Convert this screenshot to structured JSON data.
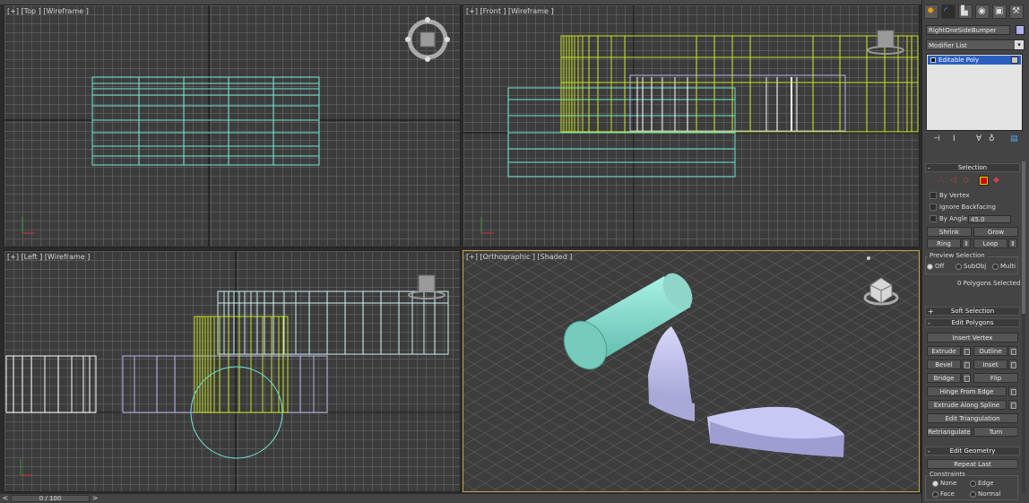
{
  "viewports": {
    "top": {
      "label": "[+] [Top ] [Wireframe ]"
    },
    "front": {
      "label": "[+] [Front ] [Wireframe ]"
    },
    "left": {
      "label": "[+] [Left ] [Wireframe ]"
    },
    "ortho": {
      "label": "[+] [Orthographic ] [Shaded ]"
    }
  },
  "timeline": {
    "frame": "0 / 100",
    "prev": "<",
    "next": ">"
  },
  "panel": {
    "object_name": "RightOneSideBumper",
    "object_color": "#b0b0ee",
    "modifier_list": "Modifier List",
    "stack": {
      "selected": "Editable Poly"
    },
    "selection": {
      "title": "Selection",
      "by_vertex": "By Vertex",
      "ignore_backfacing": "Ignore Backfacing",
      "by_angle": "By Angle:",
      "angle_value": "45.0",
      "shrink": "Shrink",
      "grow": "Grow",
      "ring": "Ring",
      "loop": "Loop",
      "preview_title": "Preview Selection",
      "preview_off": "Off",
      "preview_subobj": "SubObj",
      "preview_multi": "Multi",
      "status": "0 Polygons Selected"
    },
    "soft_selection": {
      "title": "Soft Selection"
    },
    "edit_polygons": {
      "title": "Edit Polygons",
      "insert_vertex": "Insert Vertex",
      "extrude": "Extrude",
      "outline": "Outline",
      "bevel": "Bevel",
      "inset": "Inset",
      "bridge": "Bridge",
      "flip": "Flip",
      "hinge": "Hinge From Edge",
      "extrude_spline": "Extrude Along Spline",
      "edit_tri": "Edit Triangulation",
      "retriangulate": "Retriangulate",
      "turn": "Turn"
    },
    "edit_geometry": {
      "title": "Edit Geometry",
      "repeat_last": "Repeat Last",
      "constraints": "Constraints",
      "none": "None",
      "edge": "Edge",
      "face": "Face",
      "normal": "Normal"
    }
  },
  "colors": {
    "selected_wire": "#c8e020",
    "cyan_wire": "#6fe6d2",
    "lavender": "#b4b4ee",
    "active_border": "#c9a54a"
  }
}
